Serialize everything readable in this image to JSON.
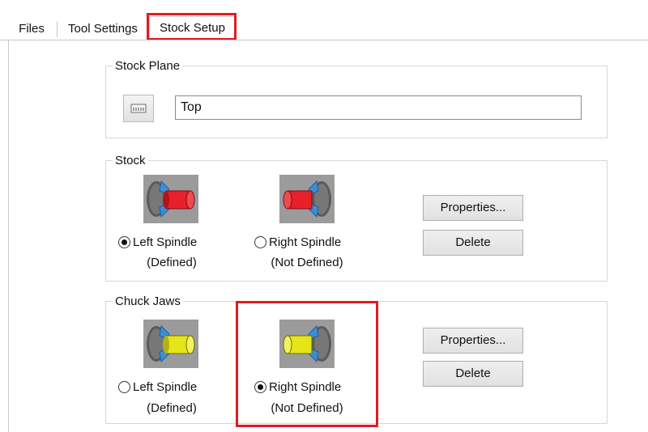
{
  "tabs": [
    {
      "label": "Files",
      "active": false
    },
    {
      "label": "Tool Settings",
      "active": false
    },
    {
      "label": "Stock Setup",
      "active": true
    }
  ],
  "stock_plane": {
    "group_label": "Stock Plane",
    "browse_icon": "plane-select-icon",
    "value": "Top"
  },
  "stock": {
    "group_label": "Stock",
    "left": {
      "label": "Left Spindle",
      "status": "(Defined)",
      "checked": true,
      "icon": "stock-left-spindle-icon"
    },
    "right": {
      "label": "Right Spindle",
      "status": "(Not Defined)",
      "checked": false,
      "icon": "stock-right-spindle-icon"
    },
    "properties_label": "Properties...",
    "delete_label": "Delete"
  },
  "chuck_jaws": {
    "group_label": "Chuck Jaws",
    "left": {
      "label": "Left Spindle",
      "status": "(Defined)",
      "checked": false,
      "icon": "chuck-left-spindle-icon"
    },
    "right": {
      "label": "Right Spindle",
      "status": "(Not Defined)",
      "checked": true,
      "icon": "chuck-right-spindle-icon"
    },
    "properties_label": "Properties...",
    "delete_label": "Delete"
  },
  "colors": {
    "highlight": "#e11b22",
    "stock_part": "#e8202a",
    "chuck_part": "#e5e51a",
    "jaw_blue": "#3a8fd8"
  }
}
